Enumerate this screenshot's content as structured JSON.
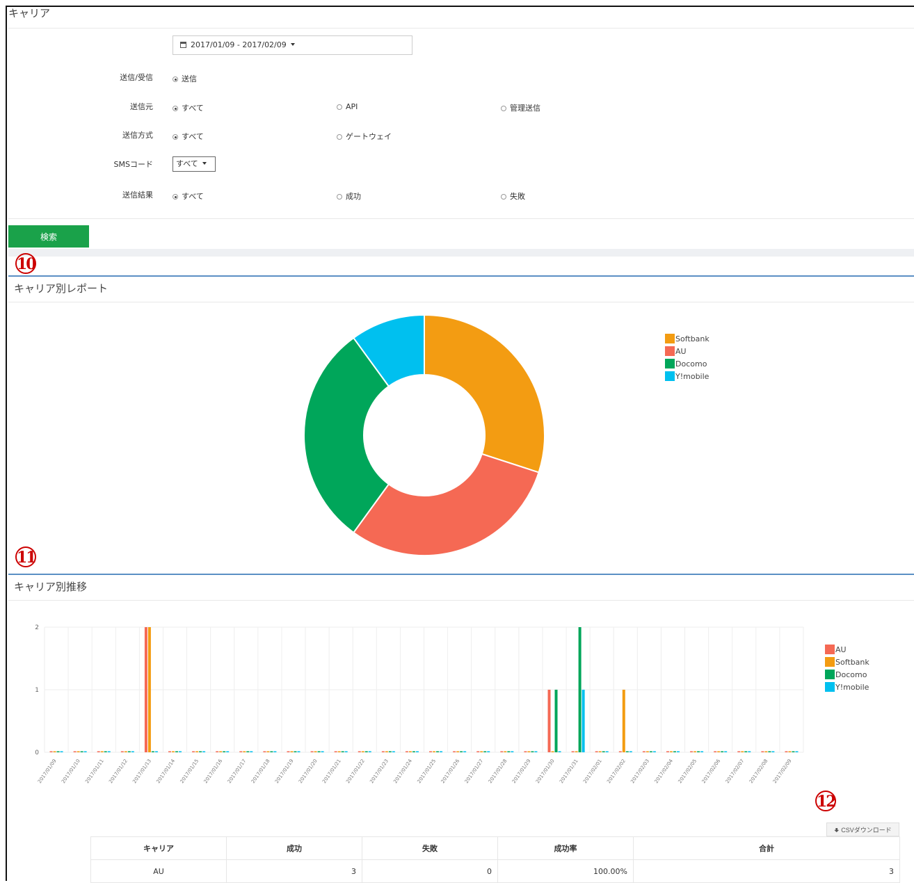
{
  "page": {
    "title": "キャリア"
  },
  "filters": {
    "date_range": "2017/01/09 - 2017/02/09",
    "rows": [
      {
        "label": "送信/受信",
        "options": [
          {
            "label": "送信",
            "checked": true
          }
        ]
      },
      {
        "label": "送信元",
        "options": [
          {
            "label": "すべて",
            "checked": true
          },
          {
            "label": "API",
            "checked": false
          },
          {
            "label": "管理送信",
            "checked": false
          }
        ]
      },
      {
        "label": "送信方式",
        "options": [
          {
            "label": "すべて",
            "checked": true
          },
          {
            "label": "ゲートウェイ",
            "checked": false
          }
        ]
      },
      {
        "label": "送信結果",
        "options": [
          {
            "label": "すべて",
            "checked": true
          },
          {
            "label": "成功",
            "checked": false
          },
          {
            "label": "失敗",
            "checked": false
          }
        ]
      }
    ],
    "sms_code": {
      "label": "SMSコード",
      "value": "すべて"
    },
    "search_label": "検索"
  },
  "badges": {
    "b10": "10",
    "b11": "11",
    "b12": "12"
  },
  "donut": {
    "title": "キャリア別レポート",
    "colors": {
      "Softbank": "#f39c12",
      "AU": "#f56954",
      "Docomo": "#00a65a",
      "Y!mobile": "#00c0ef"
    },
    "legend": [
      "Softbank",
      "AU",
      "Docomo",
      "Y!mobile"
    ]
  },
  "trend": {
    "title": "キャリア別推移",
    "legend": [
      "AU",
      "Softbank",
      "Docomo",
      "Y!mobile"
    ]
  },
  "chart_data": [
    {
      "type": "pie",
      "labels": [
        "Softbank",
        "AU",
        "Docomo",
        "Y!mobile"
      ],
      "values": [
        3,
        3,
        3,
        1
      ],
      "donut": true,
      "legend_position": "right"
    },
    {
      "type": "bar",
      "categories": [
        "2017/01/09",
        "2017/01/10",
        "2017/01/11",
        "2017/01/12",
        "2017/01/13",
        "2017/01/14",
        "2017/01/15",
        "2017/01/16",
        "2017/01/17",
        "2017/01/18",
        "2017/01/19",
        "2017/01/20",
        "2017/01/21",
        "2017/01/22",
        "2017/01/23",
        "2017/01/24",
        "2017/01/25",
        "2017/01/26",
        "2017/01/27",
        "2017/01/28",
        "2017/01/29",
        "2017/01/30",
        "2017/01/31",
        "2017/02/01",
        "2017/02/02",
        "2017/02/03",
        "2017/02/04",
        "2017/02/05",
        "2017/02/06",
        "2017/02/07",
        "2017/02/08",
        "2017/02/09"
      ],
      "series": [
        {
          "name": "AU",
          "values": [
            0,
            0,
            0,
            0,
            2,
            0,
            0,
            0,
            0,
            0,
            0,
            0,
            0,
            0,
            0,
            0,
            0,
            0,
            0,
            0,
            0,
            1,
            0,
            0,
            0,
            0,
            0,
            0,
            0,
            0,
            0,
            0
          ]
        },
        {
          "name": "Softbank",
          "values": [
            0,
            0,
            0,
            0,
            2,
            0,
            0,
            0,
            0,
            0,
            0,
            0,
            0,
            0,
            0,
            0,
            0,
            0,
            0,
            0,
            0,
            0,
            0,
            0,
            1,
            0,
            0,
            0,
            0,
            0,
            0,
            0
          ]
        },
        {
          "name": "Docomo",
          "values": [
            0,
            0,
            0,
            0,
            0,
            0,
            0,
            0,
            0,
            0,
            0,
            0,
            0,
            0,
            0,
            0,
            0,
            0,
            0,
            0,
            0,
            1,
            2,
            0,
            0,
            0,
            0,
            0,
            0,
            0,
            0,
            0
          ]
        },
        {
          "name": "Y!mobile",
          "values": [
            0,
            0,
            0,
            0,
            0,
            0,
            0,
            0,
            0,
            0,
            0,
            0,
            0,
            0,
            0,
            0,
            0,
            0,
            0,
            0,
            0,
            0,
            1,
            0,
            0,
            0,
            0,
            0,
            0,
            0,
            0,
            0
          ]
        }
      ],
      "ylim": [
        0,
        2
      ],
      "yticks": [
        0,
        1,
        2
      ],
      "grid": true,
      "legend_position": "right"
    }
  ],
  "csv_label": "CSVダウンロード",
  "table": {
    "headers": [
      "キャリア",
      "成功",
      "失敗",
      "成功率",
      "合計"
    ],
    "rows": [
      [
        "AU",
        "3",
        "0",
        "100.00%",
        "3"
      ]
    ]
  }
}
